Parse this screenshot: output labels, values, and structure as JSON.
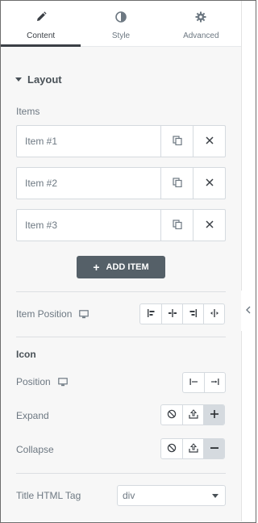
{
  "tabs": [
    {
      "label": "Content",
      "icon": "pencil-icon",
      "active": true
    },
    {
      "label": "Style",
      "icon": "half-circle-icon",
      "active": false
    },
    {
      "label": "Advanced",
      "icon": "gear-icon",
      "active": false
    }
  ],
  "section": {
    "title": "Layout"
  },
  "items": {
    "label": "Items",
    "list": [
      {
        "title": "Item #1"
      },
      {
        "title": "Item #2"
      },
      {
        "title": "Item #3"
      }
    ],
    "add_label": "ADD ITEM"
  },
  "item_position": {
    "label": "Item Position",
    "options": [
      "start",
      "center",
      "end",
      "stretch"
    ]
  },
  "icon_section": {
    "title": "Icon",
    "position_label": "Position",
    "expand_label": "Expand",
    "collapse_label": "Collapse"
  },
  "title_tag": {
    "label": "Title HTML Tag",
    "value": "div"
  },
  "colors": {
    "accent": "#556068",
    "panel": "#f7f7f7",
    "border": "#d5dadf"
  }
}
